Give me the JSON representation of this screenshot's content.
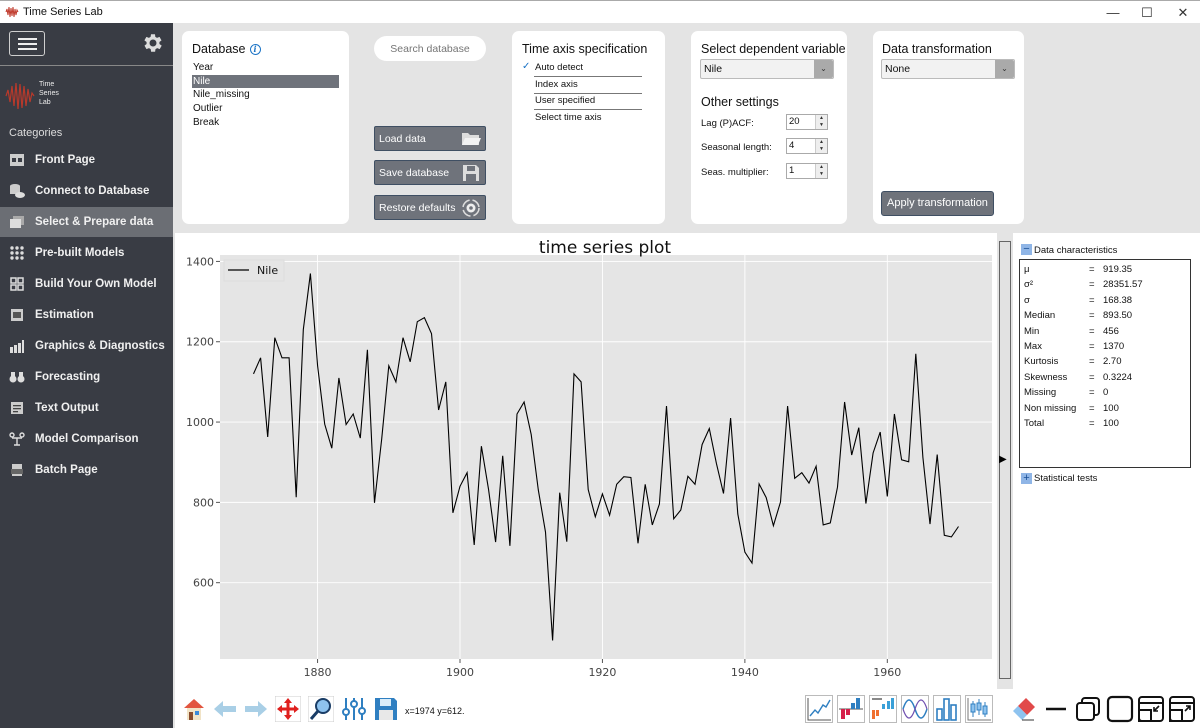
{
  "window": {
    "title": "Time Series Lab",
    "controls": [
      "minimize",
      "maximize",
      "close"
    ]
  },
  "sidebar": {
    "logo_lines": [
      "Time",
      "Series",
      "Lab"
    ],
    "categories_label": "Categories",
    "items": [
      {
        "label": "Front Page",
        "icon": "front-page-icon"
      },
      {
        "label": "Connect to Database",
        "icon": "database-cloud-icon"
      },
      {
        "label": "Select & Prepare data",
        "icon": "folders-icon",
        "active": true
      },
      {
        "label": "Pre-built Models",
        "icon": "grid-dots-icon"
      },
      {
        "label": "Build Your Own Model",
        "icon": "blocks-icon"
      },
      {
        "label": "Estimation",
        "icon": "cpu-icon"
      },
      {
        "label": "Graphics & Diagnostics",
        "icon": "bar-chart-icon"
      },
      {
        "label": "Forecasting",
        "icon": "binoculars-icon"
      },
      {
        "label": "Text Output",
        "icon": "text-doc-icon"
      },
      {
        "label": "Model Comparison",
        "icon": "scale-icon"
      },
      {
        "label": "Batch Page",
        "icon": "batch-icon"
      }
    ]
  },
  "database": {
    "title": "Database",
    "items": [
      "Year",
      "Nile",
      "Nile_missing",
      "Outlier",
      "Break"
    ],
    "selected": "Nile"
  },
  "search": {
    "placeholder": "Search database"
  },
  "buttons": {
    "load": "Load data",
    "save": "Save database",
    "restore": "Restore defaults",
    "apply": "Apply transformation"
  },
  "time_axis": {
    "title": "Time axis specification",
    "options": [
      "Auto detect",
      "Index axis",
      "User specified",
      "Select time axis"
    ],
    "checked": "Auto detect"
  },
  "dependent": {
    "title": "Select dependent variable",
    "value": "Nile",
    "other_title": "Other settings",
    "settings": [
      {
        "label": "Lag (P)ACF:",
        "value": "20"
      },
      {
        "label": "Seasonal length:",
        "value": "4"
      },
      {
        "label": "Seas. multiplier:",
        "value": "1"
      }
    ]
  },
  "transformation": {
    "title": "Data transformation",
    "value": "None"
  },
  "data_characteristics": {
    "title": "Data characteristics",
    "rows": [
      {
        "k": "μ",
        "v": "919.35"
      },
      {
        "k": "σ²",
        "v": "28351.57"
      },
      {
        "k": "σ",
        "v": "168.38"
      },
      {
        "k": "Median",
        "v": "893.50"
      },
      {
        "k": "Min",
        "v": "456"
      },
      {
        "k": "Max",
        "v": "1370"
      },
      {
        "k": "Kurtosis",
        "v": "2.70"
      },
      {
        "k": "Skewness",
        "v": "0.3224"
      },
      {
        "k": "Missing",
        "v": "0"
      },
      {
        "k": "Non missing",
        "v": "100"
      },
      {
        "k": "Total",
        "v": "100"
      }
    ],
    "eq": "=",
    "statistical_tests": "Statistical tests"
  },
  "toolbar": {
    "coords": "x=1974 y=612.",
    "left_icons": [
      "home-icon",
      "back-arrow-icon",
      "forward-arrow-icon",
      "pan-icon",
      "zoom-icon",
      "configure-subplots-icon",
      "save-figure-icon"
    ],
    "right_icons": [
      "line-plot-icon",
      "bar-diff-icon",
      "histogram-icon",
      "sine-wave-icon",
      "bar-chart-icon",
      "candlestick-icon",
      "eraser-icon",
      "minimize-icon",
      "restore-icon",
      "maximize-icon",
      "dock-in-icon",
      "undock-icon"
    ]
  },
  "chart_data": {
    "type": "line",
    "title": "time series plot",
    "xlabel": "",
    "ylabel": "",
    "legend": [
      "Nile"
    ],
    "legend_position": "top-left",
    "grid": true,
    "xlim": [
      1866.3,
      1974.7
    ],
    "ylim": [
      410,
      1416
    ],
    "xticks": [
      1880,
      1900,
      1920,
      1940,
      1960
    ],
    "yticks": [
      600,
      800,
      1000,
      1200,
      1400
    ],
    "x_start": 1871,
    "series": [
      {
        "name": "Nile",
        "values": [
          1120,
          1160,
          963,
          1210,
          1160,
          1160,
          813,
          1230,
          1370,
          1140,
          995,
          935,
          1110,
          994,
          1020,
          960,
          1180,
          799,
          958,
          1140,
          1100,
          1210,
          1150,
          1250,
          1260,
          1220,
          1030,
          1100,
          774,
          840,
          874,
          694,
          940,
          833,
          701,
          916,
          692,
          1020,
          1050,
          969,
          831,
          726,
          456,
          824,
          702,
          1120,
          1100,
          832,
          764,
          821,
          768,
          845,
          864,
          862,
          698,
          845,
          744,
          796,
          1040,
          759,
          781,
          865,
          845,
          944,
          984,
          897,
          822,
          1010,
          771,
          676,
          649,
          846,
          812,
          742,
          801,
          1040,
          860,
          874,
          848,
          890,
          744,
          749,
          838,
          1050,
          918,
          986,
          797,
          923,
          975,
          815,
          1020,
          906,
          901,
          1170,
          912,
          746,
          919,
          718,
          714,
          740
        ]
      }
    ]
  }
}
